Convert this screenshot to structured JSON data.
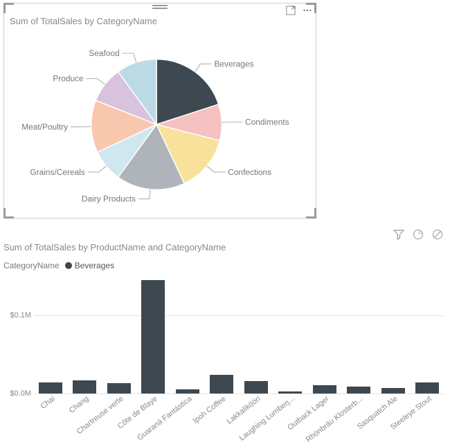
{
  "pie": {
    "title": "Sum of TotalSales by CategoryName"
  },
  "bar": {
    "title": "Sum of TotalSales by ProductName and CategoryName",
    "legend_key": "CategoryName",
    "legend_value": "Beverages",
    "ylim_label_top": "$0.1M",
    "ylim_label_bottom": "$0.0M"
  },
  "colors": {
    "series_dark": "#3d4850",
    "beverages": "#3d4850",
    "condiments": "#f6c1c1",
    "confections": "#f8e29b",
    "dairy": "#aeb4b9",
    "grains": "#cfe8ef",
    "meat": "#f7c7ae",
    "produce": "#d9c2de",
    "seafood": "#bcd9e6"
  },
  "chart_data": [
    {
      "type": "pie",
      "title": "Sum of TotalSales by CategoryName",
      "series": [
        {
          "name": "Beverages",
          "value": 20,
          "color_key": "beverages"
        },
        {
          "name": "Condiments",
          "value": 9,
          "color_key": "condiments"
        },
        {
          "name": "Confections",
          "value": 14,
          "color_key": "confections"
        },
        {
          "name": "Dairy Products",
          "value": 17,
          "color_key": "dairy"
        },
        {
          "name": "Grains/Cereals",
          "value": 8,
          "color_key": "grains"
        },
        {
          "name": "Meat/Poultry",
          "value": 13,
          "color_key": "meat"
        },
        {
          "name": "Produce",
          "value": 9,
          "color_key": "produce"
        },
        {
          "name": "Seafood",
          "value": 10,
          "color_key": "seafood"
        }
      ]
    },
    {
      "type": "bar",
      "title": "Sum of TotalSales by ProductName and CategoryName",
      "ylabel": "",
      "xlabel": "",
      "ylim": [
        0,
        150000
      ],
      "y_ticks": [
        0,
        100000
      ],
      "filter": {
        "CategoryName": "Beverages"
      },
      "categories": [
        "Chai",
        "Chang",
        "Chartreuse verte",
        "Côte de Blaye",
        "Guaraná Fantástica",
        "Ipoh Coffee",
        "Lakkalikööri",
        "Laughing Lumberj...",
        "Outback Lager",
        "Rhönbräu Klosterb...",
        "Sasquatch Ale",
        "Steeleye Stout"
      ],
      "values": [
        14000,
        17000,
        13000,
        145000,
        5000,
        24000,
        16000,
        3000,
        11000,
        9000,
        7000,
        14000
      ],
      "color_key": "series_dark"
    }
  ]
}
